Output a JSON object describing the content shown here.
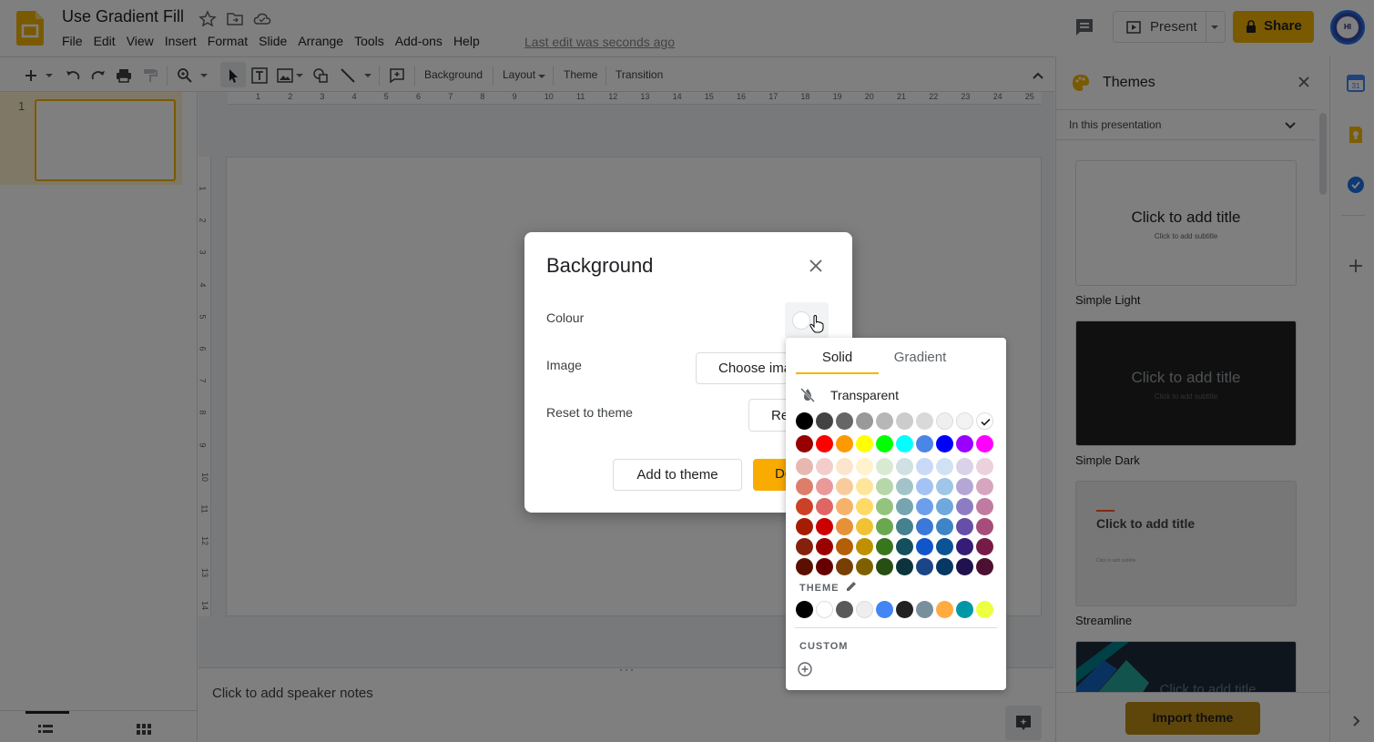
{
  "document": {
    "title": "Use Gradient Fill",
    "last_edit": "Last edit was seconds ago"
  },
  "menu": [
    "File",
    "Edit",
    "View",
    "Insert",
    "Format",
    "Slide",
    "Arrange",
    "Tools",
    "Add-ons",
    "Help"
  ],
  "header": {
    "present_label": "Present",
    "share_label": "Share",
    "avatar_initials": "HI"
  },
  "toolbar": {
    "background_label": "Background",
    "layout_label": "Layout",
    "theme_label": "Theme",
    "transition_label": "Transition"
  },
  "filmstrip": {
    "slide_number": "1"
  },
  "ruler": {
    "top_ticks": [
      "1",
      "2",
      "3",
      "4",
      "5",
      "6",
      "7",
      "8",
      "9",
      "10",
      "11",
      "12",
      "13",
      "14",
      "15",
      "16",
      "17",
      "18",
      "19",
      "20",
      "21",
      "22",
      "23",
      "24",
      "25"
    ],
    "left_ticks": [
      "1",
      "2",
      "3",
      "4",
      "5",
      "6",
      "7",
      "8",
      "9",
      "10",
      "11",
      "12",
      "13",
      "14"
    ]
  },
  "notes": {
    "placeholder": "Click to add speaker notes"
  },
  "themes_panel": {
    "title": "Themes",
    "filter_label": "In this presentation",
    "themes": [
      {
        "name": "Simple Light",
        "title": "Click to add title",
        "subtitle": "Click to add subtitle"
      },
      {
        "name": "Simple Dark",
        "title": "Click to add title",
        "subtitle": "Click to add subtitle"
      },
      {
        "name": "Streamline",
        "title": "Click to add title",
        "subtitle": "Click to add subtitle"
      },
      {
        "name": "",
        "title": "Click to add title",
        "subtitle": ""
      }
    ],
    "import_label": "Import theme"
  },
  "dialog": {
    "title": "Background",
    "colour_label": "Colour",
    "image_label": "Image",
    "choose_image_label": "Choose image",
    "reset_label": "Reset to theme",
    "reset_button_label": "Reset",
    "add_to_theme_label": "Add to theme",
    "done_label": "Done"
  },
  "colour_picker": {
    "tabs": [
      "Solid",
      "Gradient"
    ],
    "active_tab": "Solid",
    "transparent_label": "Transparent",
    "selected_colour": "#ffffff",
    "grid": [
      [
        "#000000",
        "#434343",
        "#666666",
        "#999999",
        "#b7b7b7",
        "#cccccc",
        "#d9d9d9",
        "#efefef",
        "#f3f3f3",
        "#ffffff"
      ],
      [
        "#980000",
        "#ff0000",
        "#ff9900",
        "#ffff00",
        "#00ff00",
        "#00ffff",
        "#4a86e8",
        "#0000ff",
        "#9900ff",
        "#ff00ff"
      ],
      [
        "#e6b8af",
        "#f4cccc",
        "#fce5cd",
        "#fff2cc",
        "#d9ead3",
        "#d0e0e3",
        "#c9daf8",
        "#cfe2f3",
        "#d9d2e9",
        "#ead1dc"
      ],
      [
        "#dd7e6b",
        "#ea9999",
        "#f9cb9c",
        "#ffe599",
        "#b6d7a8",
        "#a2c4c9",
        "#a4c2f4",
        "#9fc5e8",
        "#b4a7d6",
        "#d5a6bd"
      ],
      [
        "#cc4125",
        "#e06666",
        "#f6b26b",
        "#ffd966",
        "#93c47d",
        "#76a5af",
        "#6d9eeb",
        "#6fa8dc",
        "#8e7cc3",
        "#c27ba0"
      ],
      [
        "#a61c00",
        "#cc0000",
        "#e69138",
        "#f1c232",
        "#6aa84f",
        "#45818e",
        "#3c78d8",
        "#3d85c6",
        "#674ea7",
        "#a64d79"
      ],
      [
        "#85200c",
        "#990000",
        "#b45f06",
        "#bf9000",
        "#38761d",
        "#134f5c",
        "#1155cc",
        "#0b5394",
        "#351c75",
        "#741b47"
      ],
      [
        "#5b0f00",
        "#660000",
        "#783f04",
        "#7f6000",
        "#274e13",
        "#0c343d",
        "#1c4587",
        "#073763",
        "#20124d",
        "#4c1130"
      ]
    ],
    "theme_heading": "THEME",
    "theme_colours": [
      "#000000",
      "#ffffff",
      "#595959",
      "#eeeeee",
      "#4285f4",
      "#212121",
      "#78909c",
      "#ffab40",
      "#0097a7",
      "#eeff41"
    ],
    "custom_heading": "CUSTOM"
  },
  "colors": {
    "accent": "#f4b400",
    "overlay": "rgba(0,0,0,0.5)"
  }
}
